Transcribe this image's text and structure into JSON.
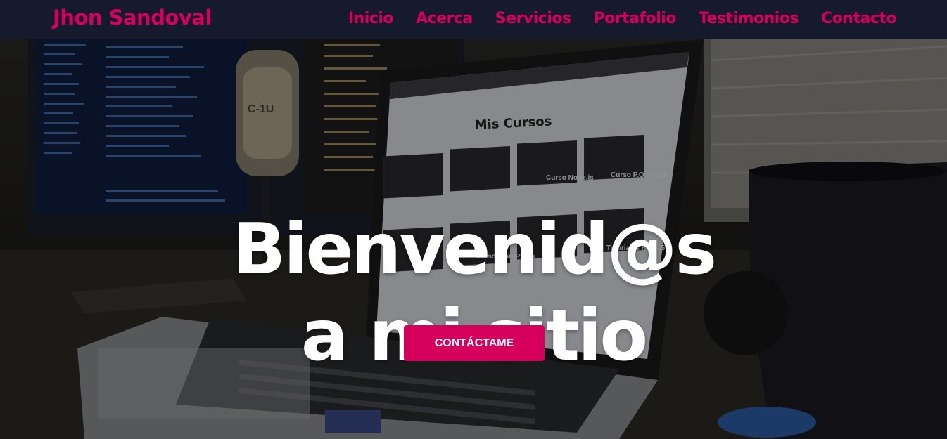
{
  "header": {
    "brand": "Jhon Sandoval",
    "nav": [
      "Inicio",
      "Acerca",
      "Servicios",
      "Portafolio",
      "Testimonios",
      "Contacto"
    ]
  },
  "hero": {
    "title_line1": "Bienvenid@s",
    "title_line2": "a mi sitio",
    "cta_label": "CONTÁCTAME",
    "background": {
      "monitor_sticker": "C-1U",
      "laptop_heading": "Mis Cursos",
      "card_labels": [
        "Curso Node.js",
        "Curso P.O.O. con",
        "Curso WordPress",
        "Tutoriales HTML5"
      ]
    }
  },
  "colors": {
    "accent": "#d6005c",
    "navbar_bg": "#151a2c",
    "hero_text": "#ffffff"
  }
}
